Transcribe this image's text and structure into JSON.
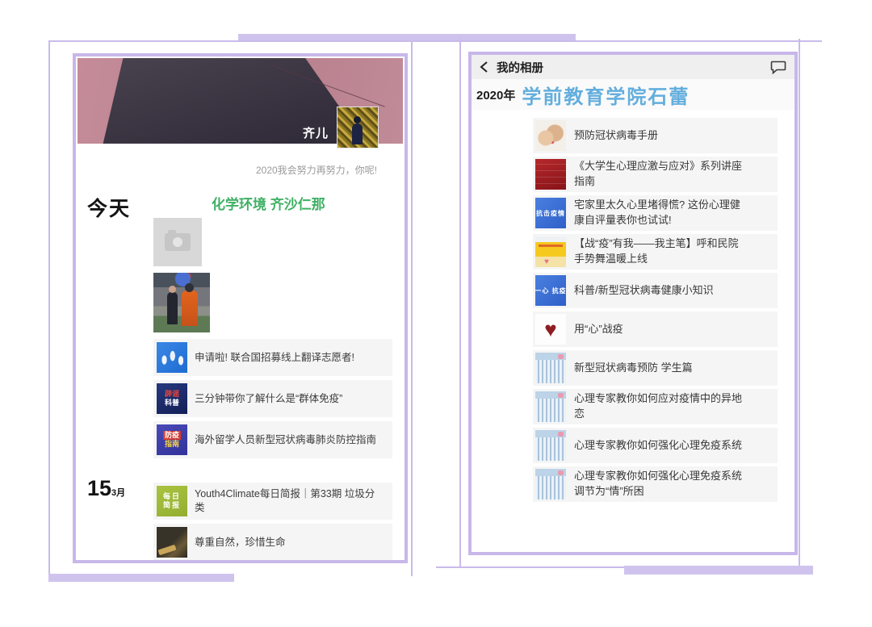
{
  "colors": {
    "frame_bar_purple": "#cfc3ee",
    "frame_line_purple": "#c9bbea",
    "panel_border_purple": "#c8b7e9",
    "moments_title_green": "#3fb065",
    "album_owner_blue": "#63aedd",
    "row_background": "#f5f5f5"
  },
  "left_phone": {
    "profile": {
      "name": "齐儿",
      "signature": "2020我会努力再努力，你呢!"
    },
    "feed": [
      {
        "date": "今天",
        "title": "化学环境 齐沙仁那",
        "articles": [
          {
            "icon": "un-volunteer-icon",
            "title": "申请啦! 联合国招募线上翻译志愿者!"
          },
          {
            "icon": "rumor-science-icon",
            "icon_line1": "辟谣",
            "icon_line2": "科普",
            "title": "三分钟带你了解什么是“群体免疫”"
          },
          {
            "icon": "epidemic-guide-icon",
            "icon_line1": "防疫",
            "icon_line2": "指南",
            "title": "海外留学人员新型冠状病毒肺炎防控指南"
          }
        ]
      },
      {
        "date_day": "15",
        "date_month": "3月",
        "articles": [
          {
            "icon": "daily-brief-icon",
            "icon_line1": "每日",
            "icon_line2": "简报",
            "title": "Youth4Climate每日简报｜第33期 垃圾分类"
          },
          {
            "icon": "nature-photo-icon",
            "title": "尊重自然，珍惜生命"
          }
        ]
      }
    ]
  },
  "right_phone": {
    "header": {
      "title": "我的相册"
    },
    "album": {
      "year": "2020年",
      "owner": "学前教育学院石蕾"
    },
    "items": [
      {
        "icon": "hands-care-icon",
        "title": "预防冠状病毒手册"
      },
      {
        "icon": "red-poster-icon",
        "title": "《大学生心理应激与应对》系列讲座指南"
      },
      {
        "icon": "blue-banner-icon",
        "icon_text": "抗击疫情",
        "title": "宅家里太久心里堵得慌? 这份心理健康自评量表你也试试!"
      },
      {
        "icon": "yellow-poster-icon",
        "title": "【战“疫”有我——我主笔】呼和民院手势舞温暖上线"
      },
      {
        "icon": "blue-banner-icon",
        "icon_text": "一心 抗疫",
        "title": "科普/新型冠状病毒健康小知识"
      },
      {
        "icon": "heart-icon",
        "title": "用“心”战疫"
      },
      {
        "icon": "crowd-illustration-icon",
        "title": "新型冠状病毒预防  学生篇"
      },
      {
        "icon": "crowd-illustration-icon",
        "title": "心理专家教你如何应对疫情中的异地恋"
      },
      {
        "icon": "crowd-illustration-icon",
        "title": "心理专家教你如何强化心理免疫系统"
      },
      {
        "icon": "crowd-illustration-icon",
        "title": "心理专家教你如何强化心理免疫系统 调节为“情”所困"
      }
    ]
  }
}
